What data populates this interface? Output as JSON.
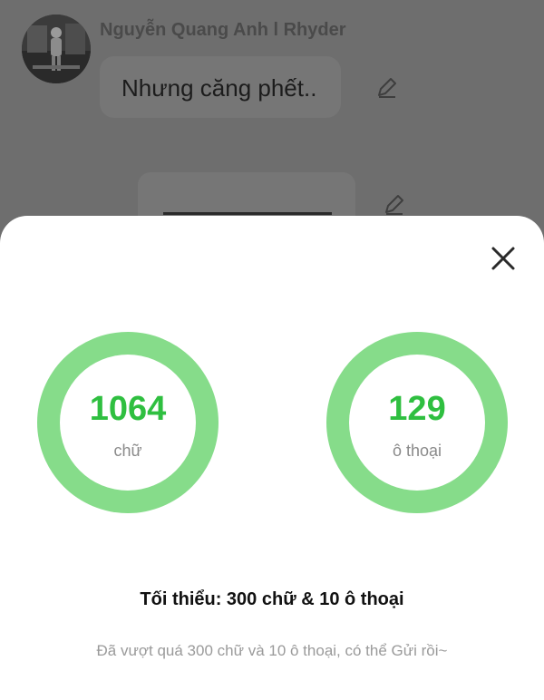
{
  "chat": {
    "sender_name": "Nguyễn Quang Anh l Rhyder",
    "message_text": "Nhưng căng phết.."
  },
  "sheet": {
    "words": {
      "value": "1064",
      "unit": "chữ"
    },
    "dialogs": {
      "value": "129",
      "unit": "ô thoại"
    },
    "minimum_label": "Tối thiểu: 300 chữ & 10 ô thoại",
    "hint": "Đã vượt quá 300 chữ và 10 ô thoại, có thể Gửi rồi~"
  },
  "colors": {
    "accent_green": "#2fbf40",
    "ring_green": "#86dc8a",
    "overlay": "#6e6e6e"
  },
  "icons": [
    "avatar-image",
    "edit-icon",
    "close-icon"
  ]
}
